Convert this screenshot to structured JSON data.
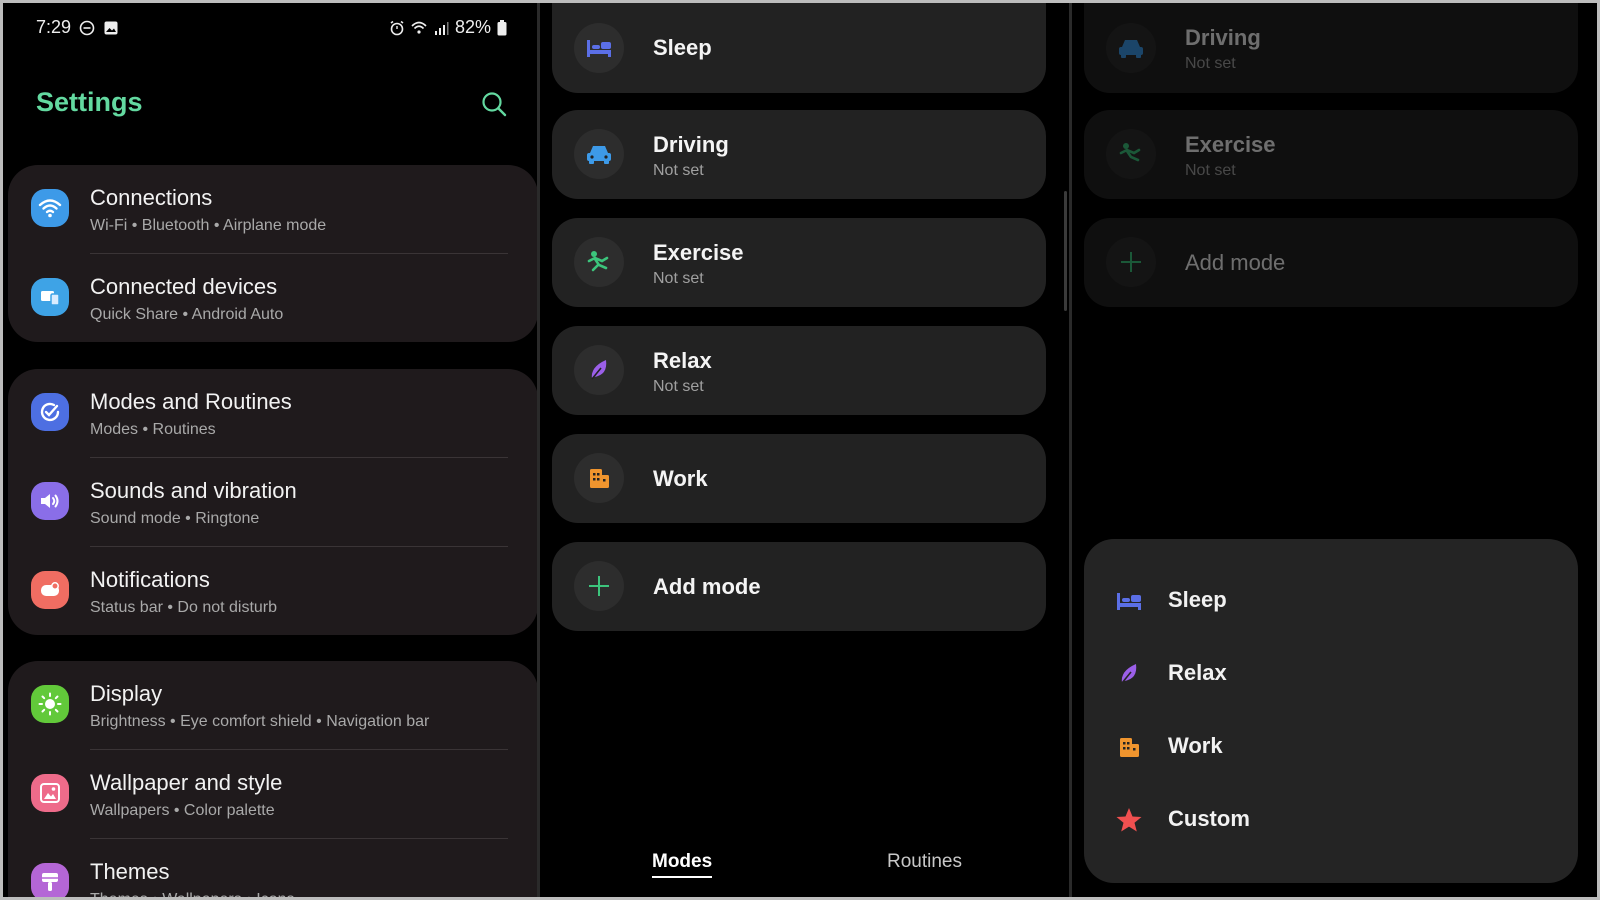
{
  "status_bar": {
    "time": "7:29",
    "battery": "82%"
  },
  "settings": {
    "title": "Settings",
    "groups": [
      [
        {
          "title": "Connections",
          "subtitle": "Wi-Fi  •  Bluetooth  •  Airplane mode",
          "icon": "wifi-icon",
          "color": "#3d9ae8"
        },
        {
          "title": "Connected devices",
          "subtitle": "Quick Share  •  Android Auto",
          "icon": "devices-icon",
          "color": "#3ea3e6"
        }
      ],
      [
        {
          "title": "Modes and Routines",
          "subtitle": "Modes  •  Routines",
          "icon": "check-circle-icon",
          "color": "#4d6fe2"
        },
        {
          "title": "Sounds and vibration",
          "subtitle": "Sound mode  •  Ringtone",
          "icon": "speaker-icon",
          "color": "#8a6ee8"
        },
        {
          "title": "Notifications",
          "subtitle": "Status bar  •  Do not disturb",
          "icon": "notification-icon",
          "color": "#f06d62"
        }
      ],
      [
        {
          "title": "Display",
          "subtitle": "Brightness  •  Eye comfort shield  •  Navigation bar",
          "icon": "sun-icon",
          "color": "#62c93a"
        },
        {
          "title": "Wallpaper and style",
          "subtitle": "Wallpapers  •  Color palette",
          "icon": "image-icon",
          "color": "#ee6b8a"
        },
        {
          "title": "Themes",
          "subtitle": "Themes  •  Wallpapers  •  Icons",
          "icon": "brush-icon",
          "color": "#b466d6"
        }
      ]
    ]
  },
  "modes": {
    "items": [
      {
        "title": "Sleep",
        "subtitle": "",
        "icon": "bed-icon"
      },
      {
        "title": "Driving",
        "subtitle": "Not set",
        "icon": "car-icon"
      },
      {
        "title": "Exercise",
        "subtitle": "Not set",
        "icon": "runner-icon"
      },
      {
        "title": "Relax",
        "subtitle": "Not set",
        "icon": "leaf-icon"
      },
      {
        "title": "Work",
        "subtitle": "",
        "icon": "building-icon"
      },
      {
        "title": "Add mode",
        "subtitle": "",
        "icon": "plus-icon"
      }
    ],
    "tabs": {
      "modes": "Modes",
      "routines": "Routines"
    }
  },
  "add_mode_sheet": {
    "background_items": [
      {
        "title": "Driving",
        "subtitle": "Not set"
      },
      {
        "title": "Exercise",
        "subtitle": "Not set"
      },
      {
        "title": "Add mode",
        "subtitle": ""
      }
    ],
    "options": [
      {
        "label": "Sleep",
        "icon": "bed-icon"
      },
      {
        "label": "Relax",
        "icon": "leaf-icon"
      },
      {
        "label": "Work",
        "icon": "building-icon"
      },
      {
        "label": "Custom",
        "icon": "star-icon"
      }
    ]
  },
  "colors": {
    "accent": "#63d9a0",
    "sleep": "#5b6fe6",
    "driving": "#3d9ae8",
    "exercise": "#3cc47c",
    "relax": "#9b5fe8",
    "work": "#f0952e",
    "custom": "#f05050"
  }
}
